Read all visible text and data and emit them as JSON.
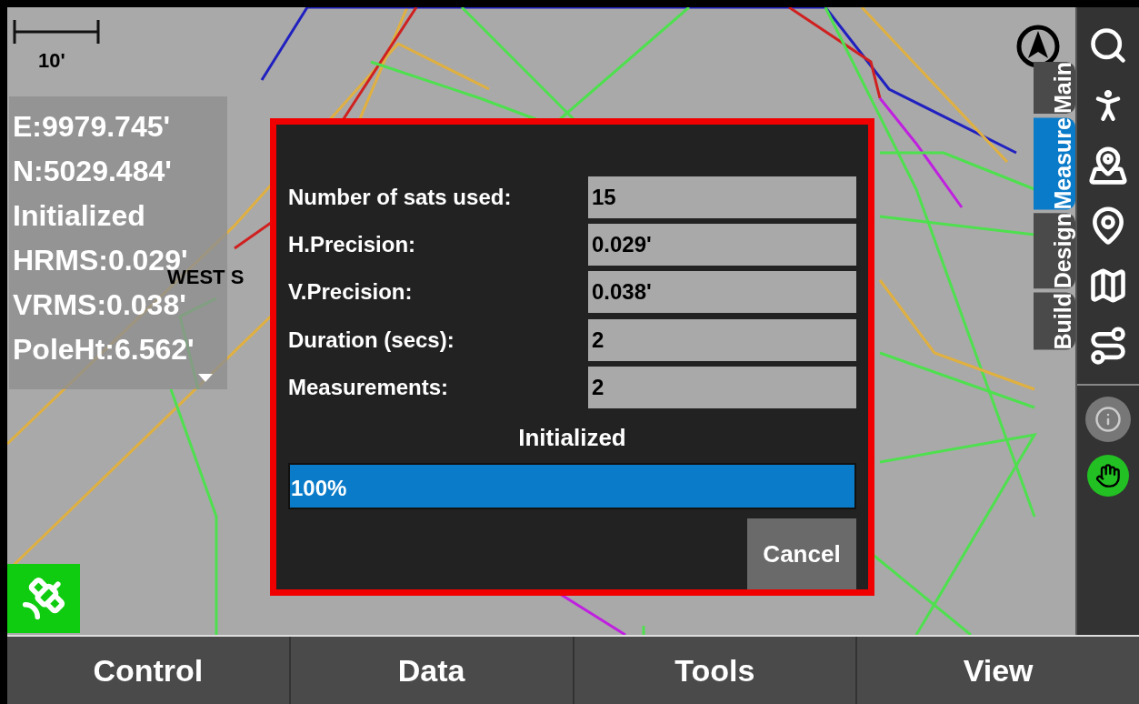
{
  "scale_bar": {
    "label": "10'"
  },
  "position_panel": {
    "lines": [
      "E:9979.745'",
      "N:5029.484'",
      "Initialized",
      "HRMS:0.029'",
      "VRMS:0.038'",
      "PoleHt:6.562'"
    ]
  },
  "map_labels": [
    "WEST S"
  ],
  "dialog": {
    "rows": [
      {
        "label": "Number of sats used:",
        "value": "15"
      },
      {
        "label": "H.Precision:",
        "value": "0.029'"
      },
      {
        "label": "V.Precision:",
        "value": "0.038'"
      },
      {
        "label": "Duration (secs):",
        "value": "2"
      },
      {
        "label": "Measurements:",
        "value": "2"
      }
    ],
    "status": "Initialized",
    "progress": {
      "level": 1,
      "reading": "100%"
    },
    "buttons": [
      "Cancel"
    ]
  },
  "side_tabs": [
    {
      "label": "Main",
      "selected": false
    },
    {
      "label": "Measure",
      "selected": true
    },
    {
      "label": "Design",
      "selected": false
    },
    {
      "label": "Build",
      "selected": false
    }
  ],
  "bottom_bar": [
    "Control",
    "Data",
    "Tools",
    "View"
  ]
}
